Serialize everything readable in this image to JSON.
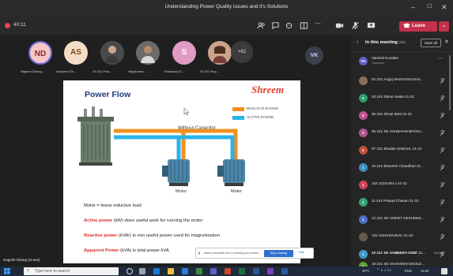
{
  "window": {
    "title": "Understanding Power Quality Issues and it's Solutions"
  },
  "toolbar": {
    "timer": "40:11",
    "leave_label": "Leave"
  },
  "participants_strip": [
    {
      "initials": "ND",
      "name": "Nagesh Dhang...",
      "bg": "#f5c6c6",
      "fg": "#8a2a2a"
    },
    {
      "initials": "AS",
      "name": "Ashpana Sh...",
      "bg": "#f4ddc6",
      "fg": "#7a4a1e"
    },
    {
      "initials": "",
      "name": "29 241 Prat...",
      "bg": "#555",
      "fg": "#fff"
    },
    {
      "initials": "",
      "name": "Vijaykumar ...",
      "bg": "#777",
      "fg": "#fff"
    },
    {
      "initials": "S",
      "name": "Shabana (G...",
      "bg": "#e09bc4",
      "fg": "#fff"
    },
    {
      "initials": "",
      "name": "26 241 Rup...",
      "bg": "#c9a38b",
      "fg": "#fff"
    }
  ],
  "more_count": "+62",
  "vk_initials": "VK",
  "slide": {
    "title": "Power Flow",
    "brand": "Shreem",
    "legend": [
      {
        "label": "REACTIVE POWER",
        "color": "#f2901d"
      },
      {
        "label": "ACTIVE POWER",
        "color": "#28b4ea"
      }
    ],
    "without_capacitor": "Without Capacitor",
    "motor_label_1": "Motor",
    "motor_label_2": "Motor",
    "line1": "Motor = linear inductive load",
    "line2_red": "Active power",
    "line2_rest": " (kW) does useful work for  running the motor",
    "line3_red": "Reactive power",
    "line3_rest": " (kVAr) is non useful power used for magnetization",
    "line4_red": "Apparent Power",
    "line4_rest": " (kVA) is total power kVA"
  },
  "share_bar": {
    "text": "teams.microsoft.com is sharing your screen.",
    "stop_label": "Stop sharing",
    "hide_label": "Hide"
  },
  "presenter": "Nagesh Dhang (Guest)",
  "panel": {
    "title": "In this meeting",
    "count": "(69)",
    "mute_all": "Mute all",
    "participants": [
      {
        "initials": "VK",
        "name": "Vaishali Kuralkar",
        "role": "Organizer",
        "color": "#5b5fc7"
      },
      {
        "initials": "",
        "name": "02 231 Angaj MADHUSUDAN...",
        "role": "",
        "color": "#8a6d5a"
      },
      {
        "initials": "0",
        "name": "03 241 Rahul Awale 21-22",
        "role": "",
        "color": "#2e9e6a"
      },
      {
        "initials": "0",
        "name": "05 231 Shruti Betti 21-22",
        "role": "",
        "color": "#c24f8f"
      },
      {
        "initials": "0",
        "name": "06 221 SE SHUBHAM BHOSA...",
        "role": "",
        "color": "#b0568e"
      },
      {
        "initials": "0",
        "name": "07 231 Bhatale SNEHAL 21-22",
        "role": "",
        "color": "#c44f3c"
      },
      {
        "initials": "1",
        "name": "10 241 Bhavesh Chaudhari 21...",
        "role": "",
        "color": "#3f8fc1"
      },
      {
        "initials": "1",
        "name": "104 342SURAJ 21-22",
        "role": "",
        "color": "#d0445d"
      },
      {
        "initials": "1",
        "name": "11 241 Prasad Chavan 21-22",
        "role": "",
        "color": "#3aa176"
      },
      {
        "initials": "1",
        "name": "12 221 SE ANIKET DESHMUK...",
        "role": "",
        "color": "#4c6fc2"
      },
      {
        "initials": "",
        "name": "125 342SHOUNAK 21-22",
        "role": "",
        "color": "#6b5b4b"
      },
      {
        "initials": "1",
        "name": "16 221 SE SAMARTH DIXIT 21...",
        "role": "",
        "color": "#e08a2c"
      },
      {
        "initials": "1",
        "name": "17 221 SE SANDESH DON...",
        "role": "On hold",
        "color": "#3b9bc6"
      },
      {
        "initials": "1",
        "name": "18 221 SE SHANNON DSOUZ...",
        "role": "",
        "color": "#5f9f3f"
      }
    ]
  },
  "taskbar": {
    "search_placeholder": "Type here to search",
    "weather": "29°C",
    "lang": "ENG",
    "time": "14:40"
  }
}
